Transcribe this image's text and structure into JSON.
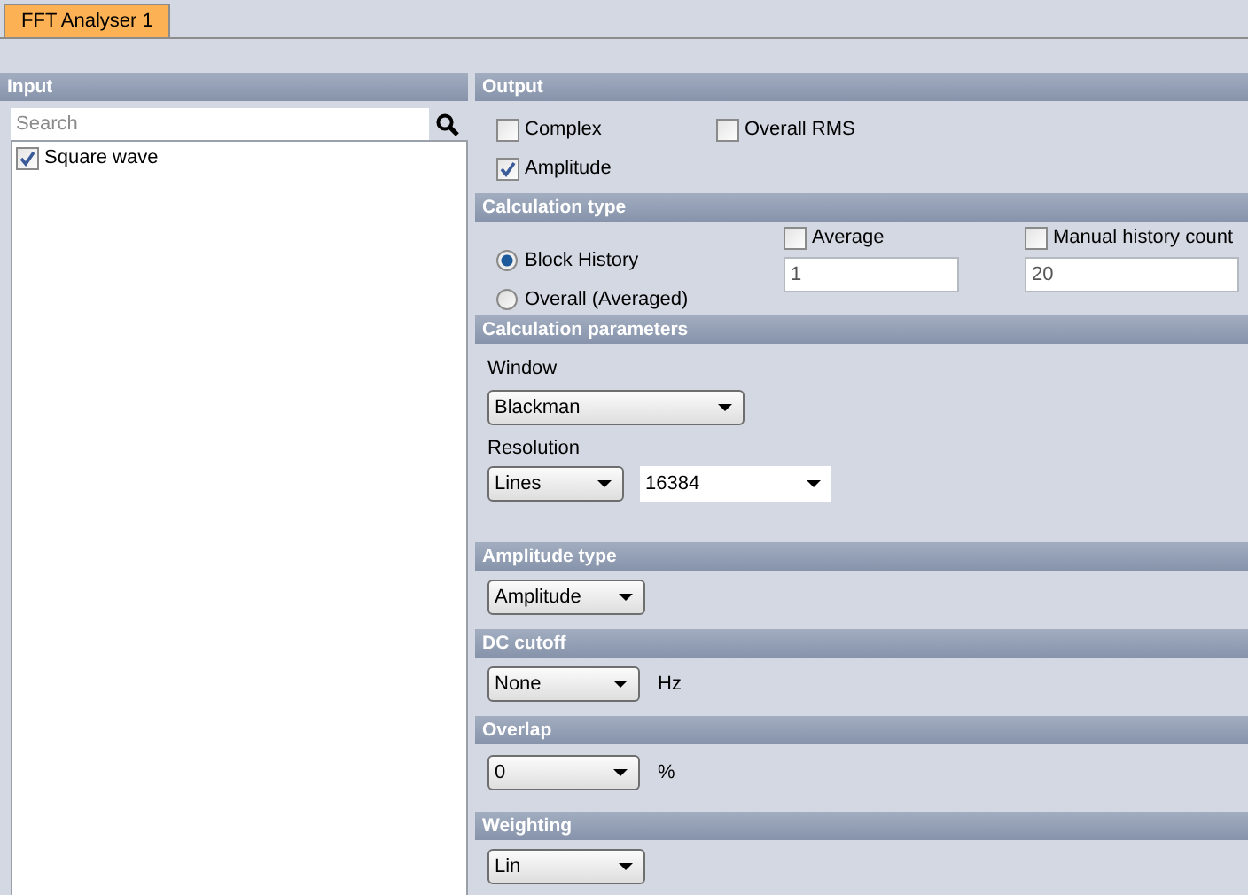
{
  "tabs": [
    {
      "label": "FFT Analyser 1",
      "selected": true
    }
  ],
  "input": {
    "title": "Input",
    "search": {
      "placeholder": "Search"
    },
    "items": [
      {
        "label": "Square wave",
        "checked": true
      }
    ]
  },
  "output": {
    "title": "Output",
    "options": [
      {
        "label": "Complex",
        "checked": false
      },
      {
        "label": "Overall RMS",
        "checked": false
      },
      {
        "label": "Amplitude",
        "checked": true
      }
    ]
  },
  "calculation_type": {
    "title": "Calculation type",
    "modes": [
      {
        "label": "Block History",
        "selected": true
      },
      {
        "label": "Overall (Averaged)",
        "selected": false
      }
    ],
    "average": {
      "label": "Average",
      "checked": false,
      "value": "1"
    },
    "manual_history": {
      "label": "Manual history count",
      "checked": false,
      "value": "20"
    }
  },
  "calculation_parameters": {
    "title": "Calculation parameters",
    "window": {
      "label": "Window",
      "value": "Blackman"
    },
    "resolution": {
      "label": "Resolution",
      "mode": "Lines",
      "value": "16384"
    }
  },
  "amplitude_type": {
    "title": "Amplitude type",
    "value": "Amplitude"
  },
  "dc_cutoff": {
    "title": "DC cutoff",
    "value": "None",
    "unit": "Hz"
  },
  "overlap": {
    "title": "Overlap",
    "value": "0",
    "unit": "%"
  },
  "weighting": {
    "title": "Weighting",
    "value": "Lin"
  }
}
